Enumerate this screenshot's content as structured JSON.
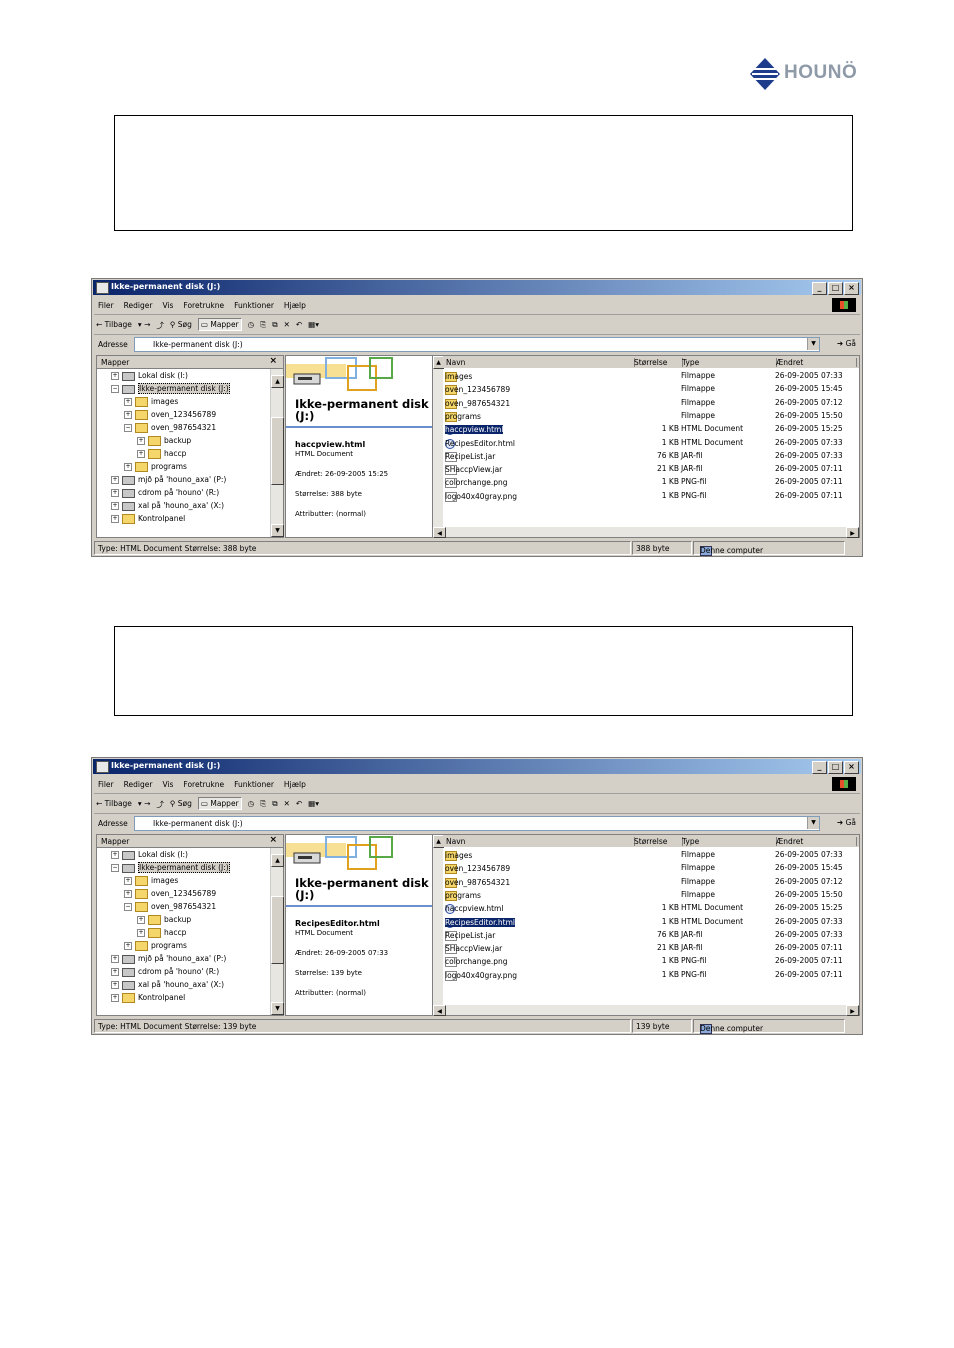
{
  "logo": {
    "text": "HOUNÖ",
    "brand_color": "#1d3c8c"
  },
  "windows": [
    {
      "title": "Ikke-permanent disk (J:)",
      "menu": [
        "Filer",
        "Rediger",
        "Vis",
        "Foretrukne",
        "Funktioner",
        "Hjælp"
      ],
      "toolbar": {
        "back": "Tilbage",
        "search": "Søg",
        "folders": "Mapper"
      },
      "address": {
        "label": "Adresse",
        "value": "Ikke-permanent disk (J:)",
        "go": "Gå"
      },
      "tree": {
        "header": "Mapper",
        "items": [
          {
            "label": "Lokal disk (I:)",
            "type": "drive",
            "pm": "+"
          },
          {
            "label": "Ikke-permanent disk (J:)",
            "type": "drive",
            "pm": "−",
            "selected": true
          },
          {
            "label": "images",
            "type": "folder",
            "pm": "+"
          },
          {
            "label": "oven_123456789",
            "type": "folder",
            "pm": "+"
          },
          {
            "label": "oven_987654321",
            "type": "folder",
            "pm": "−"
          },
          {
            "label": "backup",
            "type": "folder",
            "pm": "+"
          },
          {
            "label": "haccp",
            "type": "folder",
            "pm": "+"
          },
          {
            "label": "programs",
            "type": "folder",
            "pm": "+"
          },
          {
            "label": "mjð på 'houno_axa' (P:)",
            "type": "drive",
            "pm": "+"
          },
          {
            "label": "cdrom på 'houno' (R:)",
            "type": "drive",
            "pm": "+"
          },
          {
            "label": "xal på 'houno_axa' (X:)",
            "type": "drive",
            "pm": "+"
          },
          {
            "label": "Kontrolpanel",
            "type": "folder",
            "pm": "+"
          }
        ]
      },
      "webview": {
        "title": "Ikke-permanent disk (J:)",
        "file_name": "haccpview.html",
        "file_type": "HTML Document",
        "changed": "Ændret: 26-09-2005 15:25",
        "size": "Størrelse: 388 byte",
        "attributes": "Attributter: (normal)"
      },
      "columns": [
        "Navn",
        "Størrelse",
        "Type",
        "Ændret"
      ],
      "files": [
        {
          "name": "images",
          "size": "",
          "type": "Filmappe",
          "modified": "26-09-2005 07:33",
          "icon": "folder"
        },
        {
          "name": "oven_123456789",
          "size": "",
          "type": "Filmappe",
          "modified": "26-09-2005 15:45",
          "icon": "folder"
        },
        {
          "name": "oven_987654321",
          "size": "",
          "type": "Filmappe",
          "modified": "26-09-2005 07:12",
          "icon": "folder"
        },
        {
          "name": "programs",
          "size": "",
          "type": "Filmappe",
          "modified": "26-09-2005 15:50",
          "icon": "folder"
        },
        {
          "name": "haccpview.html",
          "size": "1 KB",
          "type": "HTML Document",
          "modified": "26-09-2005 15:25",
          "icon": "html",
          "selected": true
        },
        {
          "name": "RecipesEditor.html",
          "size": "1 KB",
          "type": "HTML Document",
          "modified": "26-09-2005 07:33",
          "icon": "html"
        },
        {
          "name": "RecipeList.jar",
          "size": "76 KB",
          "type": "JAR-fil",
          "modified": "26-09-2005 07:33",
          "icon": "file"
        },
        {
          "name": "SHaccpView.jar",
          "size": "21 KB",
          "type": "JAR-fil",
          "modified": "26-09-2005 07:11",
          "icon": "file"
        },
        {
          "name": "colorchange.png",
          "size": "1 KB",
          "type": "PNG-fil",
          "modified": "26-09-2005 07:11",
          "icon": "file"
        },
        {
          "name": "logo40x40gray.png",
          "size": "1 KB",
          "type": "PNG-fil",
          "modified": "26-09-2005 07:11",
          "icon": "file"
        }
      ],
      "status": {
        "text": "Type: HTML Document Størrelse: 388 byte",
        "size": "388 byte",
        "location": "Denne computer"
      }
    },
    {
      "title": "Ikke-permanent disk (J:)",
      "menu": [
        "Filer",
        "Rediger",
        "Vis",
        "Foretrukne",
        "Funktioner",
        "Hjælp"
      ],
      "toolbar": {
        "back": "Tilbage",
        "search": "Søg",
        "folders": "Mapper"
      },
      "address": {
        "label": "Adresse",
        "value": "Ikke-permanent disk (J:)",
        "go": "Gå"
      },
      "tree": {
        "header": "Mapper",
        "items": [
          {
            "label": "Lokal disk (I:)",
            "type": "drive",
            "pm": "+"
          },
          {
            "label": "Ikke-permanent disk (J:)",
            "type": "drive",
            "pm": "−",
            "selected": true
          },
          {
            "label": "images",
            "type": "folder",
            "pm": "+"
          },
          {
            "label": "oven_123456789",
            "type": "folder",
            "pm": "+"
          },
          {
            "label": "oven_987654321",
            "type": "folder",
            "pm": "−"
          },
          {
            "label": "backup",
            "type": "folder",
            "pm": "+"
          },
          {
            "label": "haccp",
            "type": "folder",
            "pm": "+"
          },
          {
            "label": "programs",
            "type": "folder",
            "pm": "+"
          },
          {
            "label": "mjð på 'houno_axa' (P:)",
            "type": "drive",
            "pm": "+"
          },
          {
            "label": "cdrom på 'houno' (R:)",
            "type": "drive",
            "pm": "+"
          },
          {
            "label": "xal på 'houno_axa' (X:)",
            "type": "drive",
            "pm": "+"
          },
          {
            "label": "Kontrolpanel",
            "type": "folder",
            "pm": "+"
          }
        ]
      },
      "webview": {
        "title": "Ikke-permanent disk (J:)",
        "file_name": "RecipesEditor.html",
        "file_type": "HTML Document",
        "changed": "Ændret: 26-09-2005 07:33",
        "size": "Størrelse: 139 byte",
        "attributes": "Attributter: (normal)"
      },
      "columns": [
        "Navn",
        "Størrelse",
        "Type",
        "Ændret"
      ],
      "files": [
        {
          "name": "images",
          "size": "",
          "type": "Filmappe",
          "modified": "26-09-2005 07:33",
          "icon": "folder"
        },
        {
          "name": "oven_123456789",
          "size": "",
          "type": "Filmappe",
          "modified": "26-09-2005 15:45",
          "icon": "folder"
        },
        {
          "name": "oven_987654321",
          "size": "",
          "type": "Filmappe",
          "modified": "26-09-2005 07:12",
          "icon": "folder"
        },
        {
          "name": "programs",
          "size": "",
          "type": "Filmappe",
          "modified": "26-09-2005 15:50",
          "icon": "folder"
        },
        {
          "name": "haccpview.html",
          "size": "1 KB",
          "type": "HTML Document",
          "modified": "26-09-2005 15:25",
          "icon": "html"
        },
        {
          "name": "RecipesEditor.html",
          "size": "1 KB",
          "type": "HTML Document",
          "modified": "26-09-2005 07:33",
          "icon": "html",
          "selected": true
        },
        {
          "name": "RecipeList.jar",
          "size": "76 KB",
          "type": "JAR-fil",
          "modified": "26-09-2005 07:33",
          "icon": "file"
        },
        {
          "name": "SHaccpView.jar",
          "size": "21 KB",
          "type": "JAR-fil",
          "modified": "26-09-2005 07:11",
          "icon": "file"
        },
        {
          "name": "colorchange.png",
          "size": "1 KB",
          "type": "PNG-fil",
          "modified": "26-09-2005 07:11",
          "icon": "file"
        },
        {
          "name": "logo40x40gray.png",
          "size": "1 KB",
          "type": "PNG-fil",
          "modified": "26-09-2005 07:11",
          "icon": "file"
        }
      ],
      "status": {
        "text": "Type: HTML Document Størrelse: 139 byte",
        "size": "139 byte",
        "location": "Denne computer"
      }
    }
  ]
}
